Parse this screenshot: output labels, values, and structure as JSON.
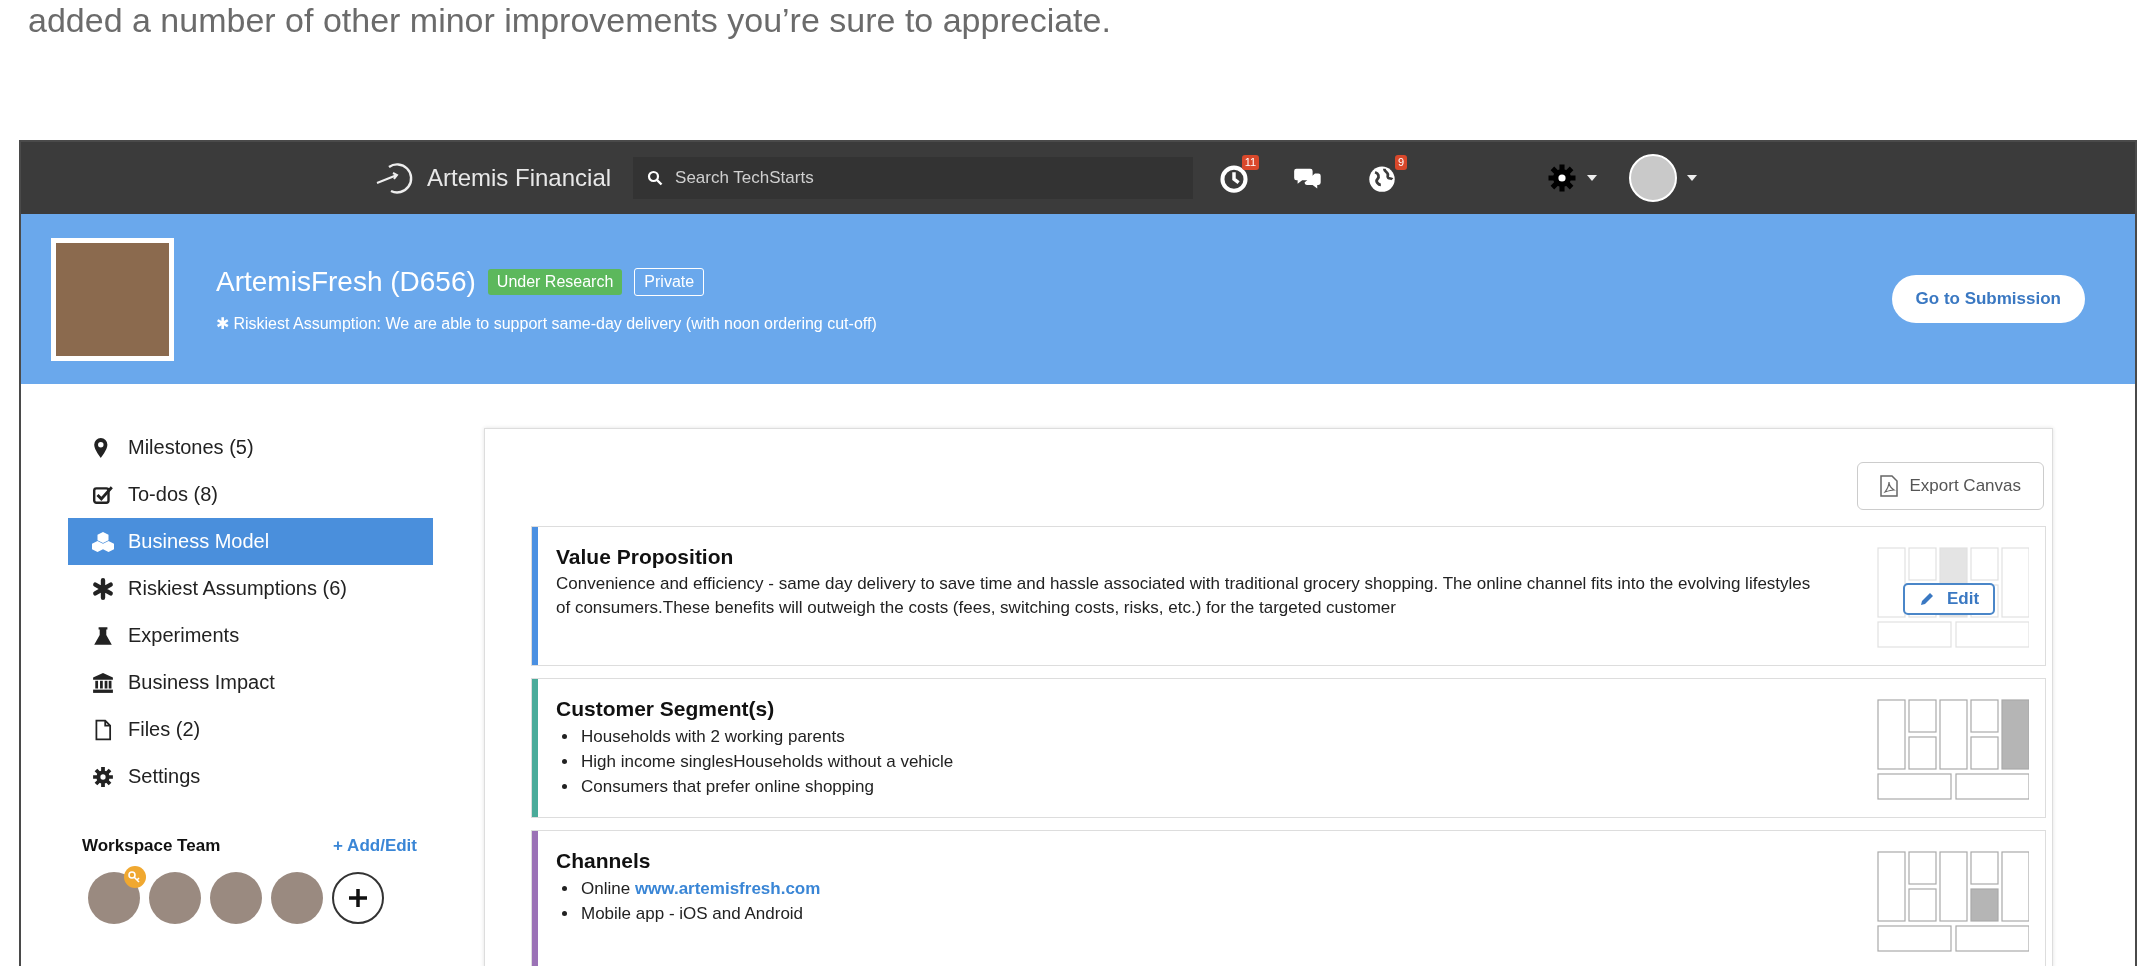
{
  "intro": "added a number of other minor improvements you’re sure to appreciate.",
  "topbar": {
    "brand": "Artemis Financial",
    "search": {
      "placeholder": "Search TechStarts"
    },
    "notifications": [
      {
        "kind": "clock",
        "badge": "11"
      },
      {
        "kind": "chat"
      },
      {
        "kind": "globe",
        "badge": "9"
      }
    ]
  },
  "header": {
    "title": "ArtemisFresh (D656)",
    "tags": [
      {
        "kind": "status",
        "label": "Under Research"
      },
      {
        "kind": "visibility",
        "label": "Private"
      }
    ],
    "subtitle": "✱ Riskiest Assumption: We are able to support same-day delivery (with noon ordering cut-off)",
    "action": "Go to Submission"
  },
  "sidebar": {
    "items": [
      {
        "label": "Milestones (5)",
        "selected": false
      },
      {
        "label": "To-dos (8)",
        "selected": false
      },
      {
        "label": "Business Model",
        "selected": true
      },
      {
        "label": "Riskiest Assumptions (6)",
        "selected": false
      },
      {
        "label": "Experiments",
        "selected": false
      },
      {
        "label": "Business Impact",
        "selected": false
      },
      {
        "label": "Files (2)",
        "selected": false
      },
      {
        "label": "Settings",
        "selected": false
      }
    ],
    "team": {
      "title": "Workspace Team",
      "action": "+ Add/Edit",
      "members": [
        {
          "admin": true
        },
        {
          "admin": false
        },
        {
          "admin": false
        },
        {
          "admin": false
        }
      ]
    }
  },
  "canvas": {
    "export_button": "Export Canvas",
    "cards": [
      {
        "kind": "value-proposition",
        "color": "#4a90e2",
        "title": "Value Proposition",
        "edit_button": "Edit",
        "text": "Convenience and efficiency - same day delivery to save time and hassle associated with traditional grocery shopping. The online channel fits into the evolving lifestyles of consumers.These benefits will outweigh the costs (fees, switching costs, risks, etc.) for the targeted customer"
      },
      {
        "kind": "customer-segments",
        "color": "#4aab9a",
        "title": "Customer Segment(s)",
        "bullets": [
          {
            "text": "Households with 2 working parents"
          },
          {
            "text": "High income singlesHouseholds without a vehicle"
          },
          {
            "text": "Consumers that prefer online shopping"
          }
        ]
      },
      {
        "kind": "channels",
        "color": "#9b72b6",
        "title": "Channels",
        "bullets": [
          {
            "text": "Online ",
            "link": "www.artemisfresh.com"
          },
          {
            "text": "Mobile app - iOS and Android"
          }
        ]
      }
    ]
  }
}
